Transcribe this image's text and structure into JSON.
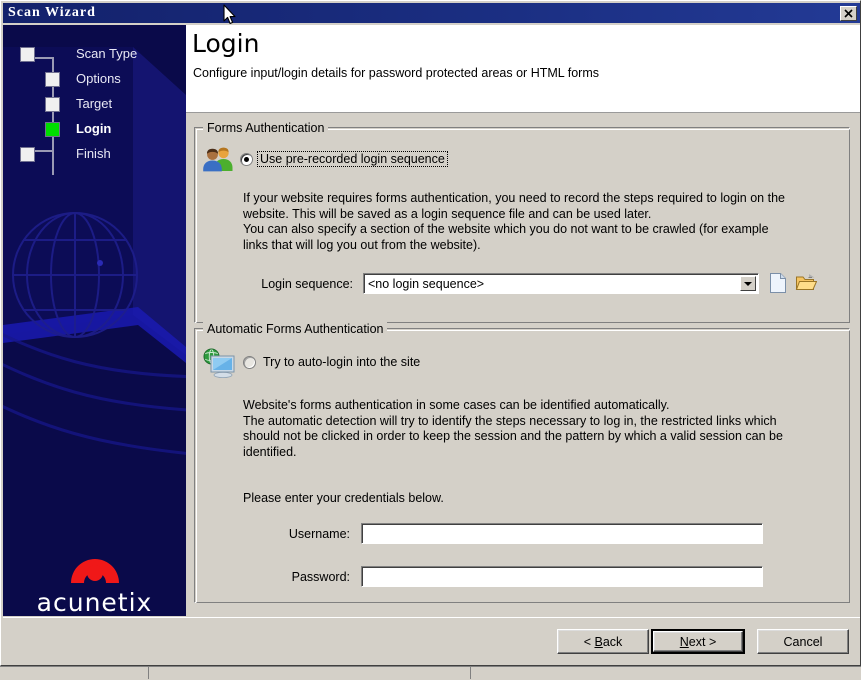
{
  "window": {
    "title": "Scan Wizard",
    "close_label": "✕"
  },
  "sidebar": {
    "steps": [
      {
        "label": "Scan Type",
        "state": "pending"
      },
      {
        "label": "Options",
        "state": "pending"
      },
      {
        "label": "Target",
        "state": "pending"
      },
      {
        "label": "Login",
        "state": "active"
      },
      {
        "label": "Finish",
        "state": "pending"
      }
    ],
    "brand": {
      "wordmark": "acunetix",
      "mark_color": "#f01818",
      "background_color": "#0a0a4a"
    }
  },
  "header": {
    "title": "Login",
    "subtitle": "Configure input/login details for password protected areas or HTML forms"
  },
  "forms_auth": {
    "group_title": "Forms Authentication",
    "icon": "two-users-icon",
    "radio_label": "Use pre-recorded login sequence",
    "radio_checked": true,
    "description_lines": [
      "If your website requires forms authentication, you need to record the steps required to login on the",
      "website. This will be saved as a login sequence file and can be used later.",
      "You can also specify a section of the website which you do not want to be crawled (for example",
      "links that will log you out from the website)."
    ],
    "sequence_label": "Login sequence:",
    "sequence_value": "<no login sequence>",
    "new_button_icon": "new-file-icon",
    "open_button_icon": "open-folder-icon"
  },
  "auto_forms_auth": {
    "group_title": "Automatic Forms Authentication",
    "icon": "computer-globe-icon",
    "radio_label": "Try to auto-login into the site",
    "radio_checked": false,
    "description_lines": [
      "Website's forms authentication in some cases can be identified automatically.",
      "The automatic detection will try to identify the steps necessary to log in, the restricted links which",
      "should not be clicked in order to keep the session and the pattern by which a valid session can be",
      "identified."
    ],
    "credentials_prompt": "Please enter your credentials below.",
    "username_label": "Username:",
    "username_value": "",
    "password_label": "Password:",
    "password_value": ""
  },
  "footer": {
    "back": {
      "prefix": "< ",
      "accel": "B",
      "rest": "ack"
    },
    "next": {
      "accel": "N",
      "rest": "ext",
      "suffix": " >"
    },
    "cancel": "Cancel"
  }
}
